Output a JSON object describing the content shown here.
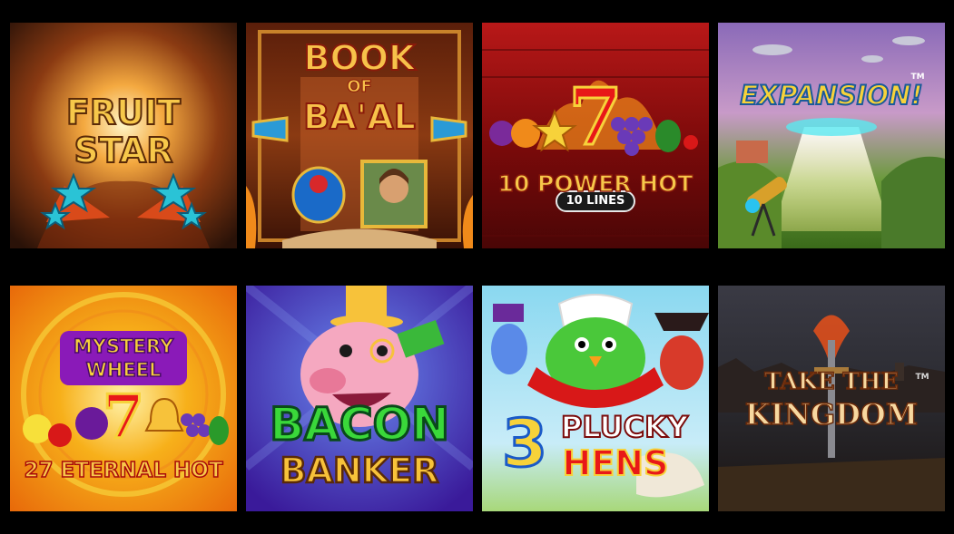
{
  "games": [
    {
      "id": "fruit-star",
      "title_line1": "FRUIT",
      "title_line2": "STAR"
    },
    {
      "id": "book-of-baal",
      "title_line1": "BOOK",
      "title_line2": "OF",
      "title_line3": "BA'AL"
    },
    {
      "id": "10-power-hot",
      "title": "10 POWER HOT",
      "subtitle": "10 LINES",
      "seven": "7"
    },
    {
      "id": "expansion",
      "title": "EXPANSION!",
      "tm": "TM"
    },
    {
      "id": "mystery-wheel-27-eternal-hot",
      "title_line1": "MYSTERY",
      "title_line2": "WHEEL",
      "title_line3": "27 ETERNAL HOT",
      "seven": "7"
    },
    {
      "id": "bacon-banker",
      "title_line1": "BACON",
      "title_line2": "BANKER"
    },
    {
      "id": "3-plucky-hens",
      "number": "3",
      "title_line1": "PLUCKY",
      "title_line2": "HENS"
    },
    {
      "id": "take-the-kingdom",
      "title_line1": "TAKE THE",
      "title_line2": "KINGDOM",
      "tm": "TM"
    }
  ],
  "colors": {
    "background": "#000000",
    "gold": "#f5c53a",
    "red": "#c8101a",
    "green": "#3db83a"
  }
}
